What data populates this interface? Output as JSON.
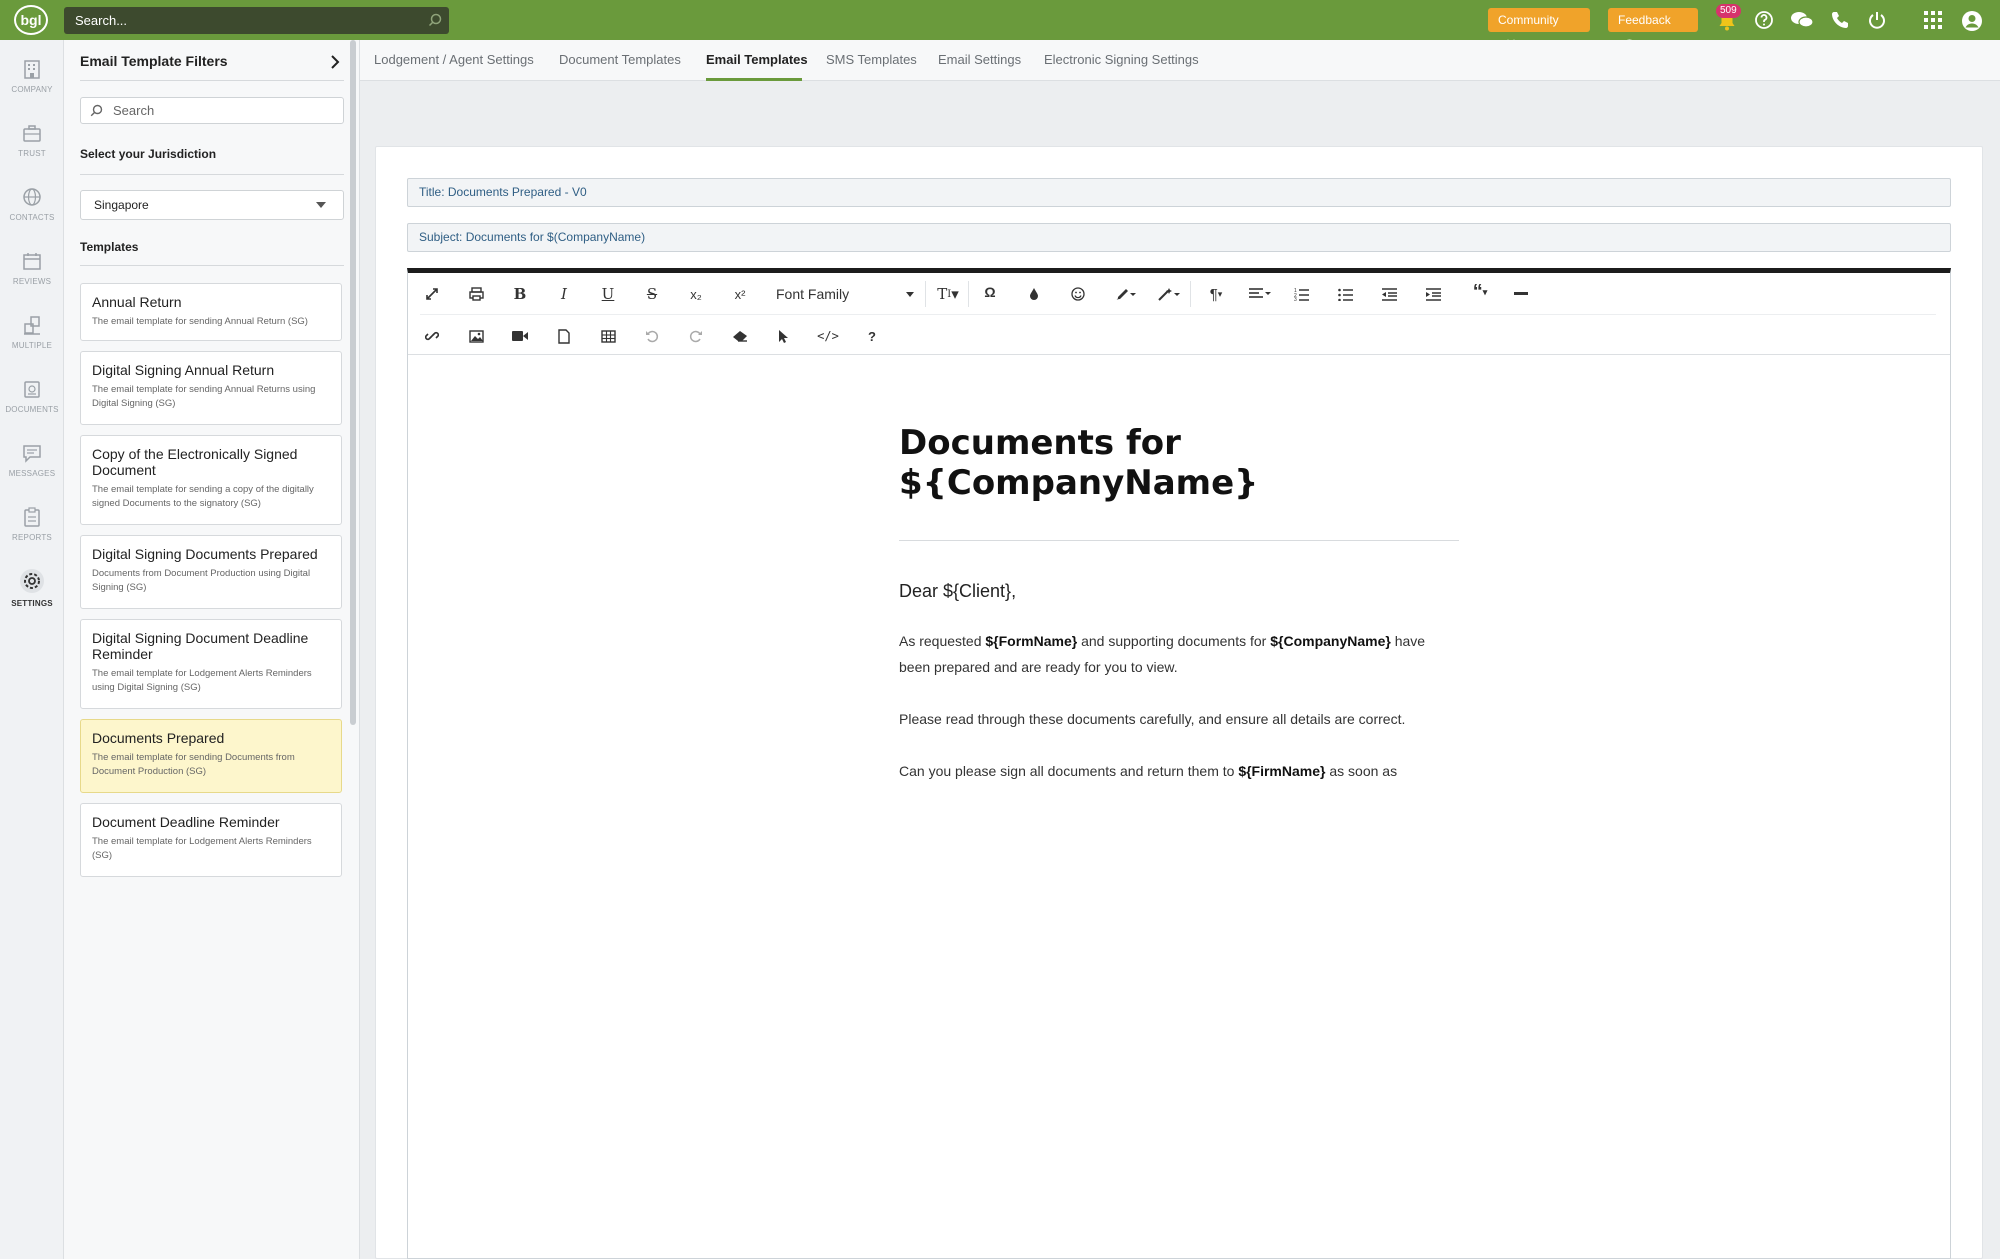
{
  "topbar": {
    "logo_text": "bgl",
    "search_placeholder": "Search...",
    "community_label": "Community",
    "feedback_label": "Feedback",
    "notification_count": "509",
    "accent_color": "#6a9a3c",
    "pill_color": "#f0a32a"
  },
  "rail": {
    "items": [
      {
        "label": "COMPANY",
        "icon": "building-icon"
      },
      {
        "label": "TRUST",
        "icon": "briefcase-icon"
      },
      {
        "label": "CONTACTS",
        "icon": "globe-icon"
      },
      {
        "label": "REVIEWS",
        "icon": "calendar-icon"
      },
      {
        "label": "MULTIPLE",
        "icon": "multiple-icon"
      },
      {
        "label": "DOCUMENTS",
        "icon": "documents-icon"
      },
      {
        "label": "MESSAGES",
        "icon": "message-icon"
      },
      {
        "label": "REPORTS",
        "icon": "clipboard-icon"
      },
      {
        "label": "SETTINGS",
        "icon": "gear-icon"
      }
    ],
    "active": "SETTINGS"
  },
  "filters": {
    "title": "Email Template Filters",
    "search_placeholder": "Search",
    "jurisdiction_label": "Select your Jurisdiction",
    "jurisdiction_value": "Singapore",
    "templates_label": "Templates",
    "templates": [
      {
        "title": "Annual Return",
        "desc": "The email template for sending Annual Return (SG)"
      },
      {
        "title": "Digital Signing Annual Return",
        "desc": "The email template for sending Annual Returns using Digital Signing (SG)"
      },
      {
        "title": "Copy of the Electronically Signed Document",
        "desc": "The email template for sending a copy of the digitally signed Documents to the signatory (SG)"
      },
      {
        "title": "Digital Signing Documents Prepared",
        "desc": "Documents from Document Production using Digital Signing (SG)"
      },
      {
        "title": "Digital Signing Document Deadline Reminder",
        "desc": "The email template for Lodgement Alerts Reminders using Digital Signing (SG)"
      },
      {
        "title": "Documents Prepared",
        "desc": "The email template for sending Documents from Document Production (SG)"
      },
      {
        "title": "Document Deadline Reminder",
        "desc": "The email template for Lodgement Alerts Reminders (SG)"
      }
    ],
    "selected_index": 5
  },
  "tabs": [
    {
      "label": "Lodgement / Agent Settings"
    },
    {
      "label": "Document Templates"
    },
    {
      "label": "Email Templates"
    },
    {
      "label": "SMS Templates"
    },
    {
      "label": "Email Settings"
    },
    {
      "label": "Electronic Signing Settings"
    }
  ],
  "active_tab": "Email Templates",
  "form": {
    "title_value": "Title: Documents Prepared - V0",
    "subject_value": "Subject: Documents for $(CompanyName)"
  },
  "editor": {
    "font_family_label": "Font Family",
    "toolbar_row1": [
      "fullscreen-icon",
      "print-icon",
      "bold-icon",
      "italic-icon",
      "underline-icon",
      "strikethrough-icon",
      "subscript-icon",
      "superscript-icon",
      "font-size-icon",
      "special-char-icon",
      "color-icon",
      "emoji-icon",
      "paint-icon",
      "magic-icon",
      "paragraph-icon",
      "align-icon",
      "ordered-list-icon",
      "unordered-list-icon",
      "outdent-icon",
      "indent-icon",
      "quote-icon",
      "horizontal-rule-icon"
    ],
    "toolbar_row2": [
      "link-icon",
      "image-icon",
      "video-icon",
      "file-icon",
      "table-icon",
      "undo-icon",
      "redo-icon",
      "clear-format-icon",
      "select-icon",
      "code-view-icon",
      "help-icon"
    ],
    "doc_title_line1": "Documents for",
    "doc_title_line2": "${CompanyName}",
    "greeting": "Dear ${Client},",
    "para1_a": "As requested ",
    "para1_b": "${FormName}",
    "para1_c": " and supporting documents for ",
    "para1_d": "${CompanyName}",
    "para1_e": " have been prepared and are ready for you to view.",
    "para2": "Please read through these documents carefully, and ensure all details are correct.",
    "para3_a": "Can you please sign all documents and return them to ",
    "para3_b": "${FirmName}",
    "para3_c": " as soon as"
  }
}
